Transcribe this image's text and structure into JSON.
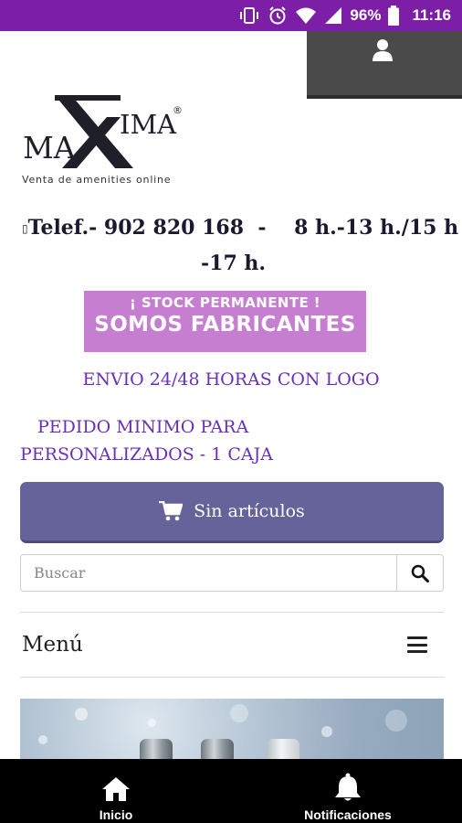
{
  "status_bar": {
    "battery": "96%",
    "time": "11:16"
  },
  "logo": {
    "brand_left": "MA",
    "brand_right": "IMA",
    "registered": "®",
    "tagline": "Venta de amenities online"
  },
  "contact": {
    "glyph": "▯",
    "phone_line": "Telef.- 902 820 168  -    8 h.-13 h./15 h",
    "phone_line2": "-17 h."
  },
  "banner": {
    "line1": "¡ STOCK PERMANENTE !",
    "line2": "SOMOS FABRICANTES"
  },
  "notices": {
    "envio": "ENVIO 24/48 HORAS CON LOGO",
    "pedido_line1": "PEDIDO MINIMO PARA",
    "pedido_line2": "PERSONALIZADOS - 1 CAJA"
  },
  "cart": {
    "label": "Sin artículos"
  },
  "search": {
    "placeholder": "Buscar"
  },
  "menu": {
    "label": "Menú"
  },
  "bottom_nav": {
    "home_label": "Inicio",
    "notifications_label": "Notificaciones"
  },
  "colors": {
    "status_bar": "#7d1fa6",
    "banner": "#c57ed0",
    "purple_text": "#6a2fb5",
    "cart_button": "#66629a"
  },
  "icons": {
    "vibrate": "vibrate-icon",
    "alarm": "alarm-icon",
    "wifi": "wifi-icon",
    "signal": "signal-icon",
    "battery": "battery-icon",
    "user": "user-icon",
    "cart": "cart-icon",
    "search": "search-icon",
    "menu": "hamburger-icon",
    "home": "home-icon",
    "bell": "bell-icon"
  }
}
